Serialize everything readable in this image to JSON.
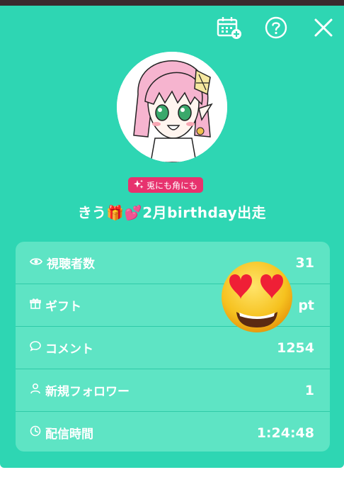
{
  "header": {
    "calendar_icon": "calendar-plus-icon",
    "help_icon": "question-circle-icon",
    "close_icon": "close-icon"
  },
  "profile": {
    "badge_text": "兎にも角にも",
    "title": "きう🎁💕2月birthday出走"
  },
  "stats": {
    "rows": [
      {
        "label": "視聴者数",
        "value": "31",
        "icon": "eye-icon"
      },
      {
        "label": "ギフト",
        "value": "pt",
        "icon": "gift-icon"
      },
      {
        "label": "コメント",
        "value": "1254",
        "icon": "comment-icon"
      },
      {
        "label": "新規フォロワー",
        "value": "1",
        "icon": "person-icon"
      },
      {
        "label": "配信時間",
        "value": "1:24:48",
        "icon": "clock-icon"
      }
    ]
  },
  "colors": {
    "accent": "#2ed6b3",
    "card": "#5ee4c4",
    "badge": "#e7326e"
  }
}
